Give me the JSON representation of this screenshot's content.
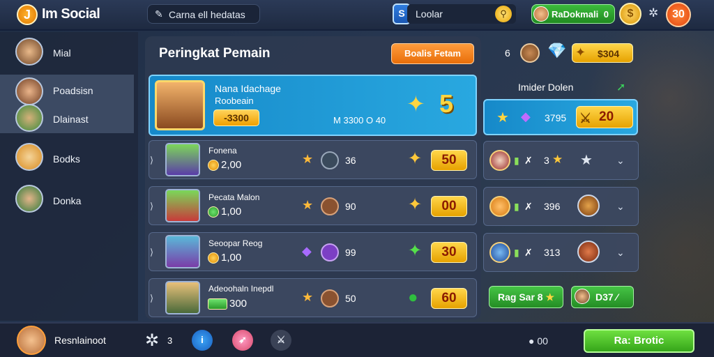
{
  "header": {
    "logo_glyph": "J",
    "app_title": "Im Social",
    "search_text": "Carna ell hedatas",
    "app_badge": "S",
    "locator_text": "Loolar",
    "profile_name": "RaDokmali",
    "profile_count": "0",
    "level": "30"
  },
  "sidebar": {
    "items": [
      {
        "label": "Mial"
      },
      {
        "label": "Poadsisn"
      },
      {
        "label": "Dlainast"
      },
      {
        "label": "Bodks"
      },
      {
        "label": "Donka"
      }
    ]
  },
  "main": {
    "title": "Peringkat Pemain",
    "action_button": "Boalis Fetam",
    "top_count": "6",
    "gold_amount": "$304",
    "featured": {
      "name": "Nana Idachage",
      "subtitle": "Roobeain",
      "score": "-3300",
      "stat": "M 3300 O 40",
      "rank": "5"
    },
    "rows": [
      {
        "name": "Fonena",
        "score": "2,00",
        "value": "36",
        "badge": "50",
        "spark": "✦",
        "spark_color": "#ffc83a",
        "item_color": "#3a4a5c"
      },
      {
        "name": "Pecata Malon",
        "score": "1,00",
        "value": "90",
        "badge": "00",
        "spark": "✦",
        "spark_color": "#ffc83a",
        "item_color": "#8a5230"
      },
      {
        "name": "Seoopar Reog",
        "score": "1,00",
        "value": "99",
        "badge": "30",
        "spark": "✦",
        "spark_color": "#55e04a",
        "item_color": "#7c3fc4"
      },
      {
        "name": "Adeoohaln Inepdl",
        "score": "300",
        "value": "50",
        "badge": "60",
        "spark": "●",
        "spark_color": "#2fbf3f",
        "item_color": "#8a5230"
      }
    ]
  },
  "right_panel": {
    "title": "Imider Dolen",
    "featured_value": "3795",
    "featured_badge": "20",
    "rows": [
      {
        "val": "3",
        "num": "",
        "has_star": true
      },
      {
        "val": "",
        "num": "396",
        "has_star": false
      },
      {
        "val": "",
        "num": "313",
        "has_star": false
      }
    ],
    "green_left": "Rag Sar 8",
    "green_right": "D37"
  },
  "footer": {
    "username": "Resnlainoot",
    "gear_count": "3",
    "count_label": "00",
    "action": "Ra: Brotic"
  },
  "colors": {
    "accent_blue": "#1689c9",
    "gold": "#ffd64a",
    "green": "#35a51a",
    "orange": "#e86e0a"
  }
}
